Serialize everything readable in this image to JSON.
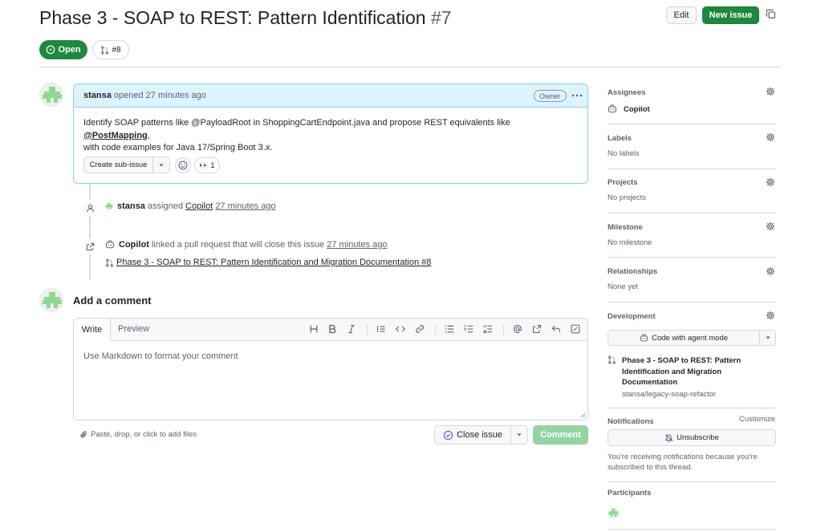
{
  "issue": {
    "title": "Phase 3 - SOAP to REST: Pattern Identification",
    "number": "#7",
    "state": "Open",
    "linked_pr": "#8"
  },
  "header": {
    "edit_label": "Edit",
    "new_issue_label": "New issue"
  },
  "comment": {
    "author": "stansa",
    "action": "opened 27 minutes ago",
    "role_badge": "Owner",
    "body_part1": "Identify SOAP patterns like @PayloadRoot in ShoppingCartEndpoint.java and propose REST equivalents like ",
    "body_mention": "@PostMapping",
    "body_part2": ",",
    "body_line2": "with code examples for Java 17/Spring Boot 3.x.",
    "create_subissue_label": "Create sub-issue",
    "reaction_emoji": "👀",
    "reaction_count": "1"
  },
  "timeline": [
    {
      "actor": "stansa",
      "verb": "assigned",
      "target": "Copilot",
      "time": "27 minutes ago"
    },
    {
      "actor": "Copilot",
      "verb": "linked a pull request that will close this issue",
      "time": "27 minutes ago",
      "pr_title": "Phase 3 - SOAP to REST: Pattern Identification and Migration Documentation #8"
    }
  ],
  "add_comment": {
    "title": "Add a comment",
    "tab_write": "Write",
    "tab_preview": "Preview",
    "placeholder": "Use Markdown to format your comment",
    "attach_label": "Paste, drop, or click to add files",
    "close_issue_label": "Close issue",
    "comment_label": "Comment"
  },
  "sidebar": {
    "assignees": {
      "heading": "Assignees",
      "value": "Copilot"
    },
    "labels": {
      "heading": "Labels",
      "value": "No labels"
    },
    "projects": {
      "heading": "Projects",
      "value": "No projects"
    },
    "milestone": {
      "heading": "Milestone",
      "value": "No milestone"
    },
    "relationships": {
      "heading": "Relationships",
      "value": "None yet"
    },
    "development": {
      "heading": "Development",
      "button_label": "Code with agent mode",
      "pr_line1": "Phase 3 - SOAP to REST: Pattern",
      "pr_line2": "Identification and Migration",
      "pr_line3": "Documentation",
      "repo": "stansa/legacy-soap-refactor"
    },
    "notifications": {
      "heading": "Notifications",
      "customize": "Customize",
      "button_label": "Unsubscribe",
      "note_line1": "You're receiving notifications because you're",
      "note_line2": "subscribed to this thread."
    },
    "participants": {
      "heading": "Participants"
    }
  },
  "colors": {
    "open_green": "#1f883d",
    "comment_header_bg": "#ddf4ff",
    "comment_border": "#8cccf2",
    "disabled_green": "#94d3a2"
  }
}
